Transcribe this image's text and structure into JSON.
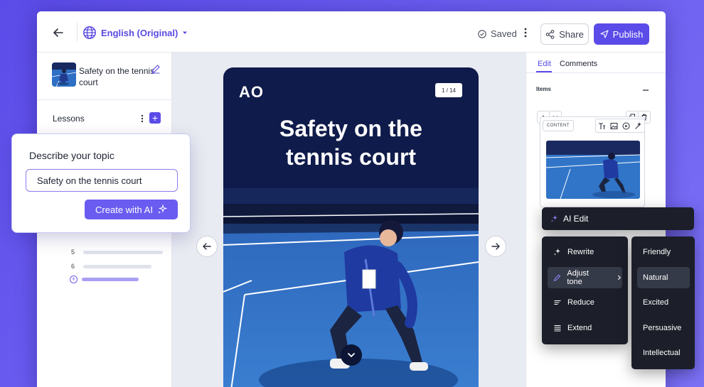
{
  "topbar": {
    "language": "English (Original)",
    "saved_label": "Saved",
    "share_label": "Share",
    "publish_label": "Publish"
  },
  "course": {
    "title": "Safety on the tennis court"
  },
  "lessons": {
    "label": "Lessons",
    "items": [
      {
        "number": "5"
      },
      {
        "number": "6"
      }
    ]
  },
  "popup": {
    "title": "Describe your topic",
    "input_value": "Safety on the tennis court",
    "create_label": "Create with AI"
  },
  "card": {
    "logo": "AO",
    "page_indicator": "1 / 14",
    "title_line1": "Safety on the",
    "title_line2": "tennis court"
  },
  "right_panel": {
    "tab_edit": "Edit",
    "tab_comments": "Comments",
    "items_label": "Items",
    "content_chip": "CONTENT"
  },
  "ai_edit": {
    "label": "AI Edit",
    "actions": [
      {
        "label": "Rewrite"
      },
      {
        "label": "Adjust tone"
      },
      {
        "label": "Reduce"
      },
      {
        "label": "Extend"
      }
    ],
    "tones": [
      {
        "label": "Friendly"
      },
      {
        "label": "Natural"
      },
      {
        "label": "Excited"
      },
      {
        "label": "Persuasive"
      },
      {
        "label": "Intellectual"
      }
    ]
  },
  "colors": {
    "accent": "#5b4be8",
    "card_bg": "#0f1b4a",
    "menu_bg": "#1c1f29",
    "court_blue": "#2f6fc4"
  },
  "icons": {
    "back": "arrow-left-icon",
    "language": "globe-icon",
    "saved": "check-circle-icon",
    "share": "share-icon",
    "publish": "send-icon",
    "ai": "sparkle-icon"
  }
}
